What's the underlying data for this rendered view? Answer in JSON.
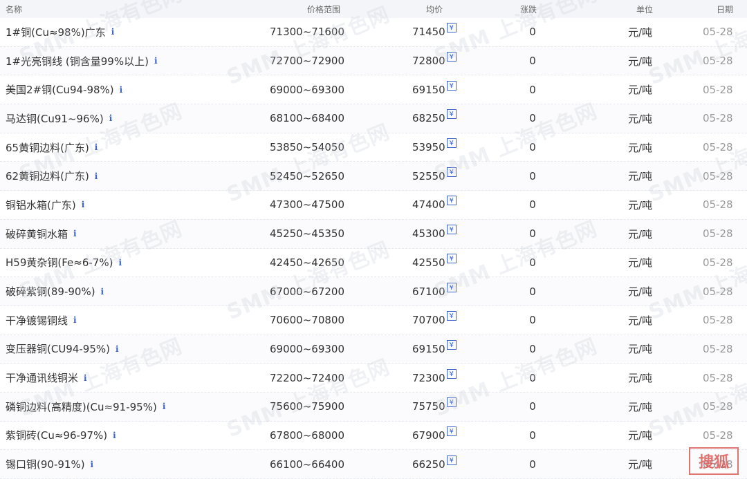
{
  "header": {
    "name": "名称",
    "range": "价格范围",
    "avg": "均价",
    "change": "涨跌",
    "unit": "单位",
    "date": "日期"
  },
  "rows": [
    {
      "name": "1#铜(Cu≈98%)广东",
      "range": "71300~71600",
      "avg": "71450",
      "change": "0",
      "unit": "元/吨",
      "date": "05-28"
    },
    {
      "name": "1#光亮铜线 (铜含量99%以上)",
      "range": "72700~72900",
      "avg": "72800",
      "change": "0",
      "unit": "元/吨",
      "date": "05-28"
    },
    {
      "name": "美国2#铜(Cu94-98%)",
      "range": "69000~69300",
      "avg": "69150",
      "change": "0",
      "unit": "元/吨",
      "date": "05-28"
    },
    {
      "name": "马达铜(Cu91~96%)",
      "range": "68100~68400",
      "avg": "68250",
      "change": "0",
      "unit": "元/吨",
      "date": "05-28"
    },
    {
      "name": "65黄铜边料(广东)",
      "range": "53850~54050",
      "avg": "53950",
      "change": "0",
      "unit": "元/吨",
      "date": "05-28"
    },
    {
      "name": "62黄铜边料(广东)",
      "range": "52450~52650",
      "avg": "52550",
      "change": "0",
      "unit": "元/吨",
      "date": "05-28"
    },
    {
      "name": "铜铝水箱(广东)",
      "range": "47300~47500",
      "avg": "47400",
      "change": "0",
      "unit": "元/吨",
      "date": "05-28"
    },
    {
      "name": "破碎黄铜水箱",
      "range": "45250~45350",
      "avg": "45300",
      "change": "0",
      "unit": "元/吨",
      "date": "05-28"
    },
    {
      "name": "H59黄杂铜(Fe≈6-7%)",
      "range": "42450~42650",
      "avg": "42550",
      "change": "0",
      "unit": "元/吨",
      "date": "05-28"
    },
    {
      "name": "破碎紫铜(89-90%)",
      "range": "67000~67200",
      "avg": "67100",
      "change": "0",
      "unit": "元/吨",
      "date": "05-28"
    },
    {
      "name": "干净镀锡铜线",
      "range": "70600~70800",
      "avg": "70700",
      "change": "0",
      "unit": "元/吨",
      "date": "05-28"
    },
    {
      "name": "变压器铜(CU94-95%)",
      "range": "69000~69300",
      "avg": "69150",
      "change": "0",
      "unit": "元/吨",
      "date": "05-28"
    },
    {
      "name": "干净通讯线铜米",
      "range": "72200~72400",
      "avg": "72300",
      "change": "0",
      "unit": "元/吨",
      "date": "05-28"
    },
    {
      "name": "磷铜边料(高精度)(Cu≈91-95%)",
      "range": "75600~75900",
      "avg": "75750",
      "change": "0",
      "unit": "元/吨",
      "date": "05-28"
    },
    {
      "name": "紫铜砖(Cu≈96-97%)",
      "range": "67800~68000",
      "avg": "67900",
      "change": "0",
      "unit": "元/吨",
      "date": "05-28"
    },
    {
      "name": "锡口铜(90-91%)",
      "range": "66100~66400",
      "avg": "66250",
      "change": "0",
      "unit": "元/吨",
      "date": "05-28"
    }
  ],
  "icons": {
    "info": "i",
    "yen": "¥"
  },
  "watermark_text": "SMM 上海有色网",
  "stamp_text": "搜狐",
  "colors": {
    "info_icon": "#3a62c8",
    "header_bg": "#f4f5f8",
    "stamp": "#d9534f"
  }
}
